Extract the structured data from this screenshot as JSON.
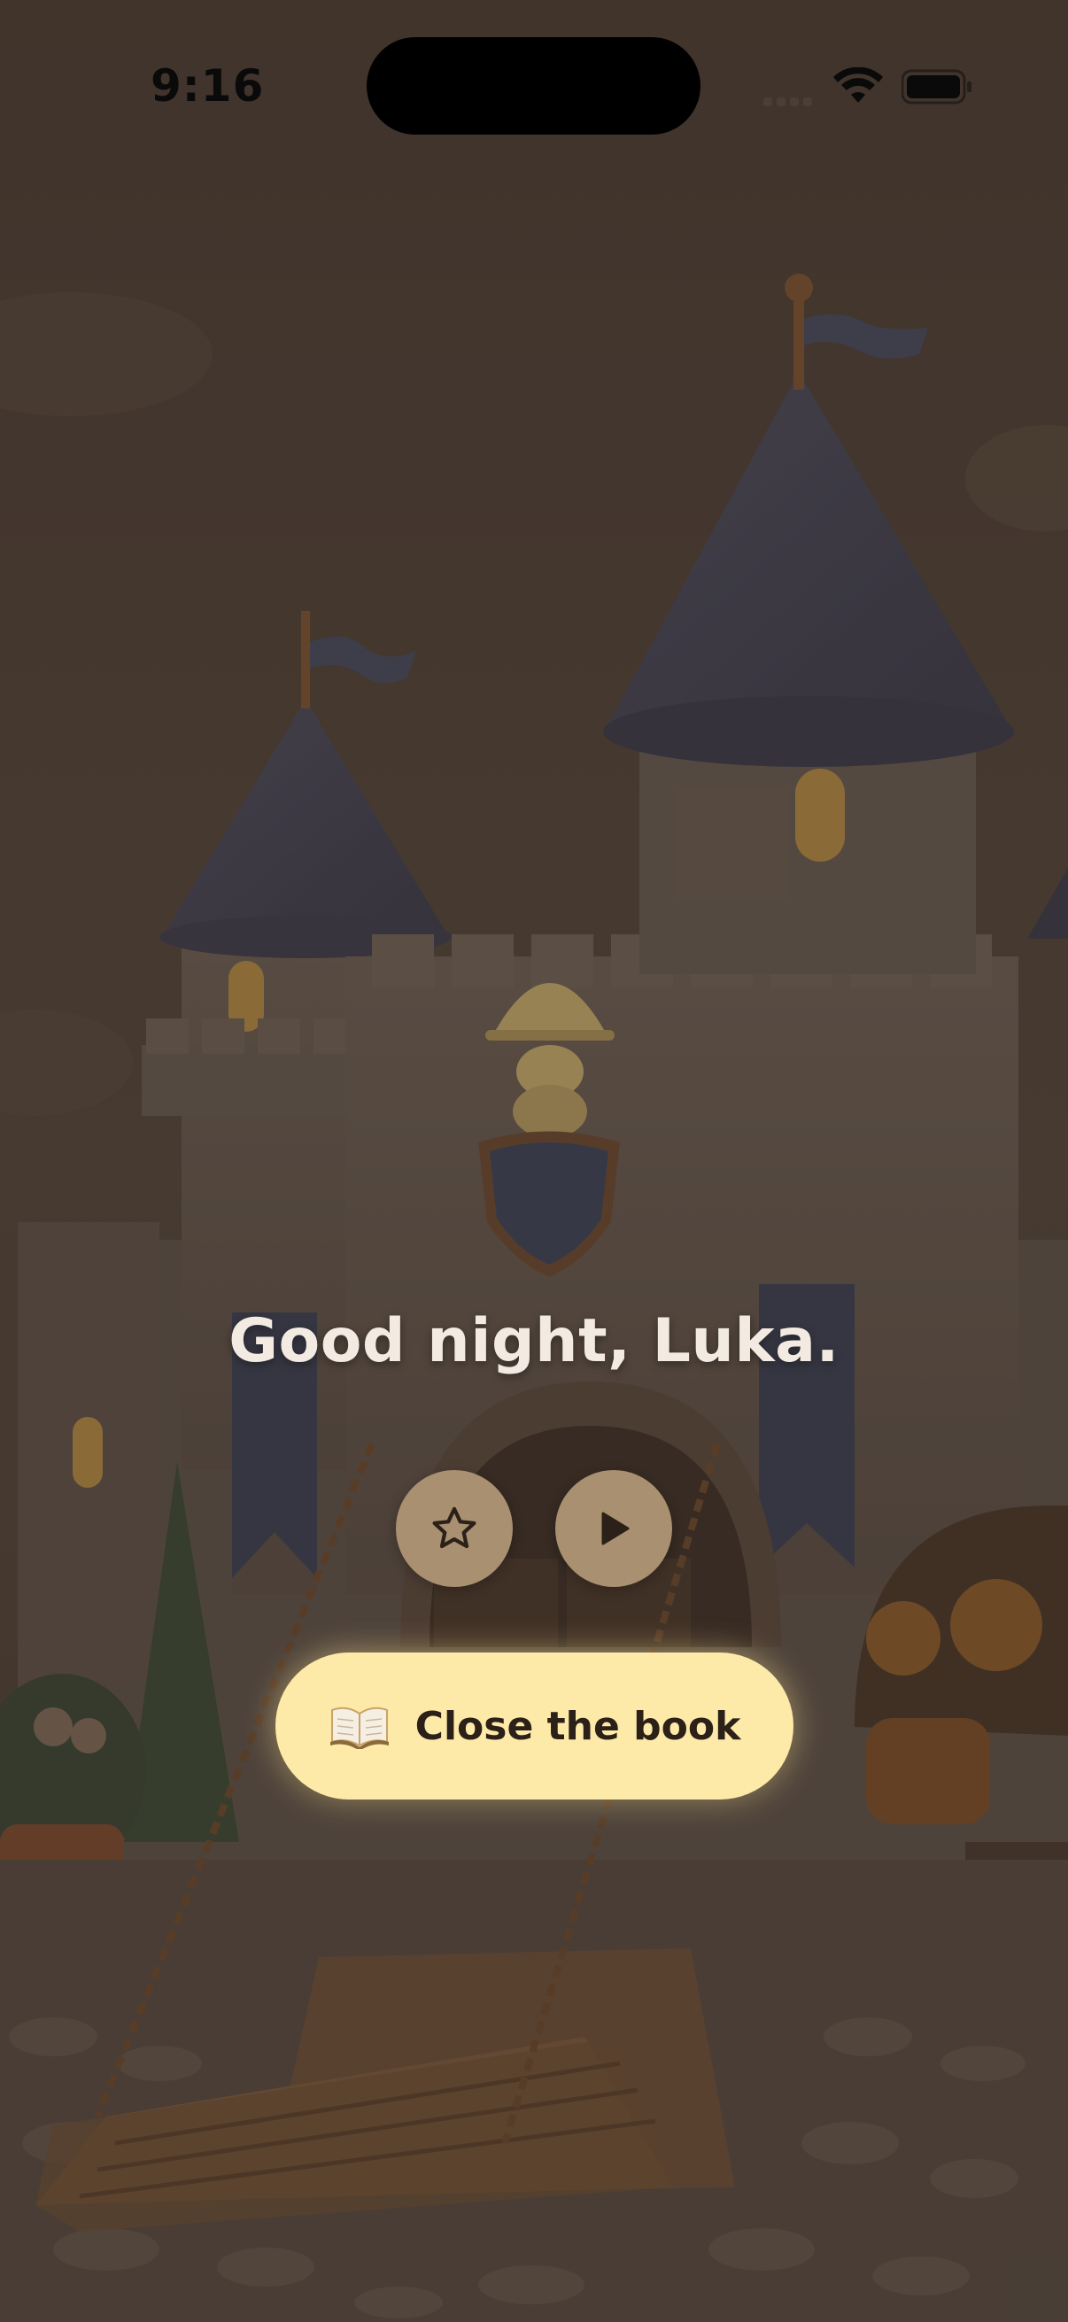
{
  "status_bar": {
    "time": "9:16"
  },
  "greeting": {
    "text": "Good night, Luka."
  },
  "controls": {
    "favorite_icon": "star-icon",
    "play_icon": "play-icon"
  },
  "close_book": {
    "icon": "open-book-icon",
    "label": "Close the book"
  },
  "colors": {
    "button_primary": "#fdeaa8",
    "button_round": "#a89070",
    "greeting_text": "#f3ebe2"
  }
}
